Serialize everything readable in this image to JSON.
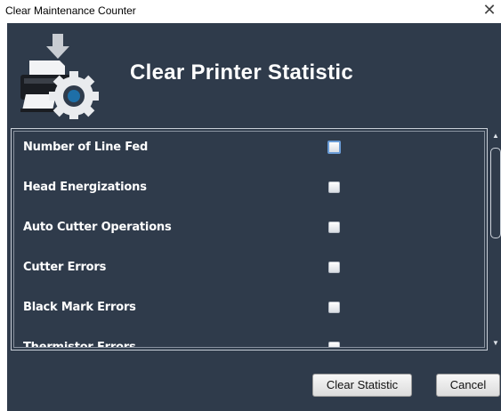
{
  "window": {
    "title": "Clear Maintenance Counter",
    "close_glyph": "✕"
  },
  "header": {
    "title": "Clear Printer Statistic",
    "icon": "printer-gear-icon"
  },
  "statistics": [
    {
      "label": "Number of Line Fed",
      "checked": false,
      "focused": true
    },
    {
      "label": "Head Energizations",
      "checked": false
    },
    {
      "label": "Auto Cutter Operations",
      "checked": false
    },
    {
      "label": "Cutter Errors",
      "checked": false
    },
    {
      "label": "Black Mark Errors",
      "checked": false
    },
    {
      "label": "Thermistor Errors",
      "checked": false
    }
  ],
  "buttons": {
    "clear": "Clear Statistic",
    "cancel": "Cancel"
  },
  "colors": {
    "dialog_bg": "#2f3b4b",
    "text": "#ffffff",
    "focus": "#6a9cd6"
  }
}
